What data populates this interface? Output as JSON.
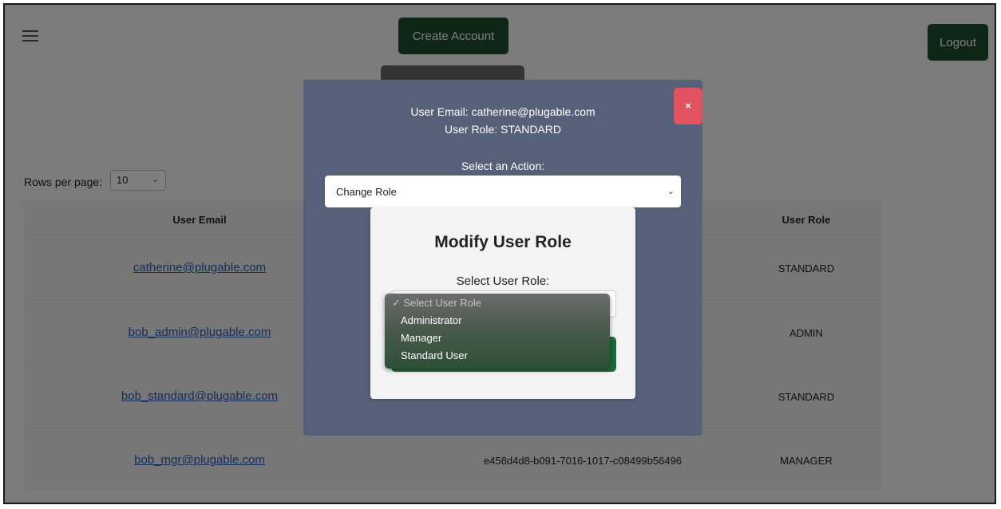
{
  "header": {
    "create_account_label": "Create Account",
    "logout_label": "Logout"
  },
  "table": {
    "rows_per_page_label": "Rows per page:",
    "rows_per_page_value": "10",
    "headers": {
      "email": "User Email",
      "role": "User Role"
    },
    "rows": [
      {
        "email": "catherine@plugable.com",
        "id": "",
        "role": "STANDARD"
      },
      {
        "email": "bob_admin@plugable.com",
        "id": "",
        "role": "ADMIN"
      },
      {
        "email": "bob_standard@plugable.com",
        "id": "",
        "role": "STANDARD"
      },
      {
        "email": "bob_mgr@plugable.com",
        "id": "e458d4d8-b091-7016-1017-c08499b56496",
        "role": "MANAGER"
      }
    ]
  },
  "modal": {
    "user_email_line": "User Email: catherine@plugable.com",
    "user_role_line": "User Role: STANDARD",
    "close_label": "×",
    "select_action_label": "Select an Action:",
    "action_value": "Change Role"
  },
  "role_modal": {
    "title": "Modify User Role",
    "select_label": "Select User Role:",
    "options": [
      {
        "label": "✓ Select User Role"
      },
      {
        "label": "Administrator"
      },
      {
        "label": "Manager"
      },
      {
        "label": "Standard User"
      }
    ]
  },
  "icons": [
    "hamburger-menu-icon",
    "chevron-down-icon",
    "close-icon",
    "checkmark-icon"
  ],
  "colors": {
    "primary_green": "#1d4d2b",
    "close_red": "#e25260",
    "modal_bg": "#566079",
    "link_blue": "#2a5db0"
  }
}
